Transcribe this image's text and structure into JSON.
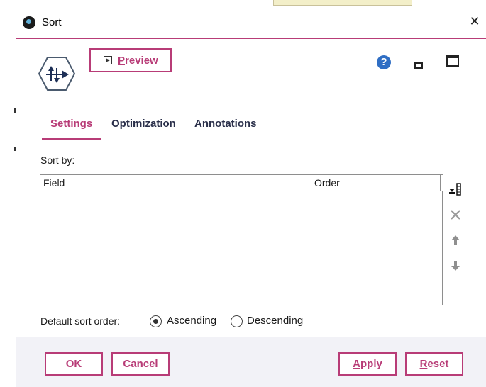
{
  "window": {
    "title": "Sort",
    "close_icon": "close-icon"
  },
  "toolbar": {
    "preview_label": "Preview",
    "preview_mnemonic": "P",
    "preview_rest": "review",
    "help_icon": "help-icon",
    "minimize_icon": "minimize-icon",
    "maximize_icon": "maximize-icon",
    "node_icon": "sort-node-icon"
  },
  "tabs": [
    {
      "label": "Settings",
      "active": true
    },
    {
      "label": "Optimization",
      "active": false
    },
    {
      "label": "Annotations",
      "active": false
    }
  ],
  "settings": {
    "sort_by_label": "Sort by:",
    "table": {
      "columns": [
        "Field",
        "Order"
      ],
      "rows": []
    },
    "side_buttons": [
      "pick-field-icon",
      "delete-icon",
      "move-up-icon",
      "move-down-icon"
    ],
    "default_sort_order_label": "Default sort order:",
    "options": [
      {
        "pre": "As",
        "mnemonic": "c",
        "post": "ending",
        "selected": true
      },
      {
        "pre": "",
        "mnemonic": "D",
        "post": "escending",
        "selected": false
      }
    ]
  },
  "footer": {
    "ok": "OK",
    "cancel": "Cancel",
    "apply_mnemonic": "A",
    "apply_rest": "pply",
    "reset_mnemonic": "R",
    "reset_rest": "eset"
  },
  "colors": {
    "accent": "#b83c77",
    "help": "#2f6ec4",
    "footer_bg": "#f2f2f7"
  }
}
